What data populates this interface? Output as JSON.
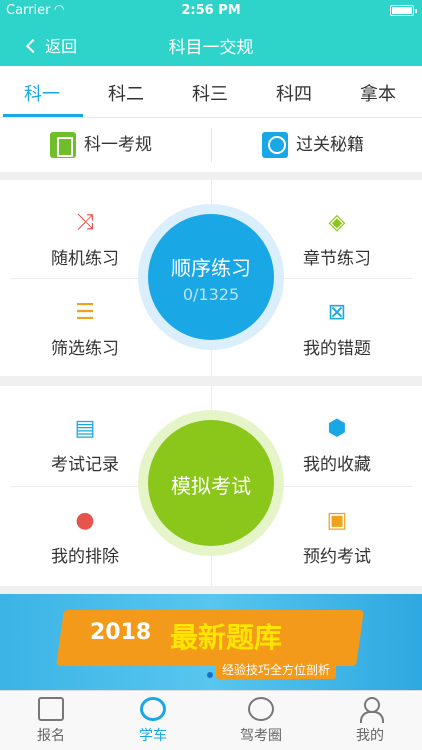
{
  "status_bar": {
    "carrier": "Carrier",
    "time": "2:56 PM"
  },
  "nav": {
    "back_label": "返回",
    "title": "科目一交规"
  },
  "tabs": [
    {
      "label": "科一",
      "active": true
    },
    {
      "label": "科二",
      "active": false
    },
    {
      "label": "科三",
      "active": false
    },
    {
      "label": "科四",
      "active": false
    },
    {
      "label": "拿本",
      "active": false
    }
  ],
  "quick_links": [
    {
      "label": "科一考规",
      "icon": "book-icon",
      "color": "#6fbf2a"
    },
    {
      "label": "过关秘籍",
      "icon": "medal-icon",
      "color": "#1aa7e6"
    }
  ],
  "practice": {
    "center": {
      "title": "顺序练习",
      "progress": "0/1325"
    },
    "items": [
      {
        "label": "随机练习",
        "icon": "shuffle-icon",
        "glyph": "⤨",
        "color": "#e8534c"
      },
      {
        "label": "章节练习",
        "icon": "layers-icon",
        "glyph": "◈",
        "color": "#8bc61b"
      },
      {
        "label": "筛选练习",
        "icon": "filter-icon",
        "glyph": "☰",
        "color": "#f0a21b"
      },
      {
        "label": "我的错题",
        "icon": "wrong-book-icon",
        "glyph": "⊠",
        "color": "#1aa7e6"
      }
    ]
  },
  "exam": {
    "center": {
      "title": "模拟考试"
    },
    "items": [
      {
        "label": "考试记录",
        "icon": "clipboard-icon",
        "glyph": "▤",
        "color": "#1aa7e6"
      },
      {
        "label": "我的收藏",
        "icon": "cube-icon",
        "glyph": "⬢",
        "color": "#1aa7e6"
      },
      {
        "label": "我的排除",
        "icon": "chart-icon",
        "glyph": "●",
        "color": "#e8534c"
      },
      {
        "label": "预约考试",
        "icon": "appointment-icon",
        "glyph": "▣",
        "color": "#f0a21b"
      }
    ]
  },
  "banner": {
    "year": "2018",
    "headline": "最新题库",
    "subline": "经验技巧全方位剖析"
  },
  "tabbar": [
    {
      "label": "报名",
      "icon": "id-card-icon",
      "active": false
    },
    {
      "label": "学车",
      "icon": "steering-wheel-icon",
      "active": true
    },
    {
      "label": "驾考圈",
      "icon": "compass-icon",
      "active": false
    },
    {
      "label": "我的",
      "icon": "person-icon",
      "active": false
    }
  ]
}
